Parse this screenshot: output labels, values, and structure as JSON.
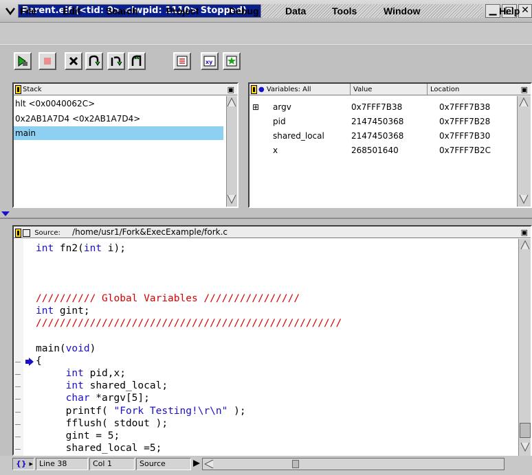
{
  "window": {
    "title_app": "Parent.elf",
    "title_status": "(<tid: 0>  <lwpid: 1110> Stopped)",
    "minimize_glyph": "▁",
    "maximize_glyph": "□",
    "close_glyph": "✕"
  },
  "menu": {
    "items": [
      "File",
      "Edit",
      "Search",
      "Project",
      "Debug",
      "Data",
      "Tools",
      "Window"
    ],
    "help": "Help"
  },
  "toolbar": {
    "icons": [
      "step-into-icon",
      "stop-icon",
      "delete-icon",
      "step-over-icon",
      "step-out-icon",
      "step-instruction-icon",
      "list-icon",
      "xy-plot-icon",
      "compile-icon"
    ]
  },
  "stack": {
    "title": "Stack",
    "frames": [
      "hlt <0x0040062C>",
      "0x2AB1A7D4 <0x2AB1A7D4>",
      "main"
    ],
    "selected_index": 2
  },
  "variables": {
    "title": "Variables: All",
    "col_value": "Value",
    "col_location": "Location",
    "rows": [
      {
        "expand": "⊞",
        "name": "argv",
        "value": "0x7FFF7B38",
        "location": "0x7FFF7B38"
      },
      {
        "expand": "",
        "name": "pid",
        "value": "2147450368",
        "location": "0x7FFF7B28"
      },
      {
        "expand": "",
        "name": "shared_local",
        "value": "2147450368",
        "location": "0x7FFF7B30"
      },
      {
        "expand": "",
        "name": "x",
        "value": "268501640",
        "location": "0x7FFF7B2C"
      }
    ]
  },
  "source": {
    "label": "Source:",
    "path": "/home/usr1/Fork&ExecExample/fork.c",
    "lines": [
      {
        "segs": [
          [
            "kw",
            "int"
          ],
          [
            "t",
            " fn2("
          ],
          [
            "kw",
            "int"
          ],
          [
            "t",
            " i);"
          ]
        ]
      },
      {
        "segs": []
      },
      {
        "segs": []
      },
      {
        "segs": []
      },
      {
        "segs": [
          [
            "cmt",
            "////////// Global Variables ////////////////"
          ]
        ]
      },
      {
        "segs": [
          [
            "kw",
            "int"
          ],
          [
            "t",
            " gint;"
          ]
        ]
      },
      {
        "segs": [
          [
            "cmt",
            "///////////////////////////////////////////////////"
          ]
        ]
      },
      {
        "segs": []
      },
      {
        "segs": [
          [
            "t",
            "main("
          ],
          [
            "kw",
            "void"
          ],
          [
            "t",
            ")"
          ]
        ]
      },
      {
        "segs": [
          [
            "t",
            "{"
          ]
        ]
      },
      {
        "segs": [
          [
            "t",
            "     "
          ],
          [
            "kw",
            "int"
          ],
          [
            "t",
            " pid,x;"
          ]
        ]
      },
      {
        "segs": [
          [
            "t",
            "     "
          ],
          [
            "kw",
            "int"
          ],
          [
            "t",
            " shared_local;"
          ]
        ]
      },
      {
        "segs": [
          [
            "t",
            "     "
          ],
          [
            "kw",
            "char"
          ],
          [
            "t",
            " *argv[5];"
          ]
        ]
      },
      {
        "segs": [
          [
            "t",
            "     printf( "
          ],
          [
            "kw",
            "\"Fork Testing!\\r\\n\""
          ],
          [
            "t",
            " );"
          ]
        ]
      },
      {
        "segs": [
          [
            "t",
            "     fflush( stdout );"
          ]
        ]
      },
      {
        "segs": [
          [
            "t",
            "     gint = 5;"
          ]
        ]
      },
      {
        "segs": [
          [
            "t",
            "     shared_local =5;"
          ]
        ]
      }
    ],
    "current_line_index": 9
  },
  "status": {
    "braces": "{}",
    "line": "Line 38",
    "col": "Col 1",
    "mode": "Source"
  },
  "colors": {
    "title_bg": "#0a1f8f",
    "selection": "#8ed0f2",
    "keyword": "#1a10c8",
    "comment": "#d80000",
    "marker": "#1a10c8"
  }
}
